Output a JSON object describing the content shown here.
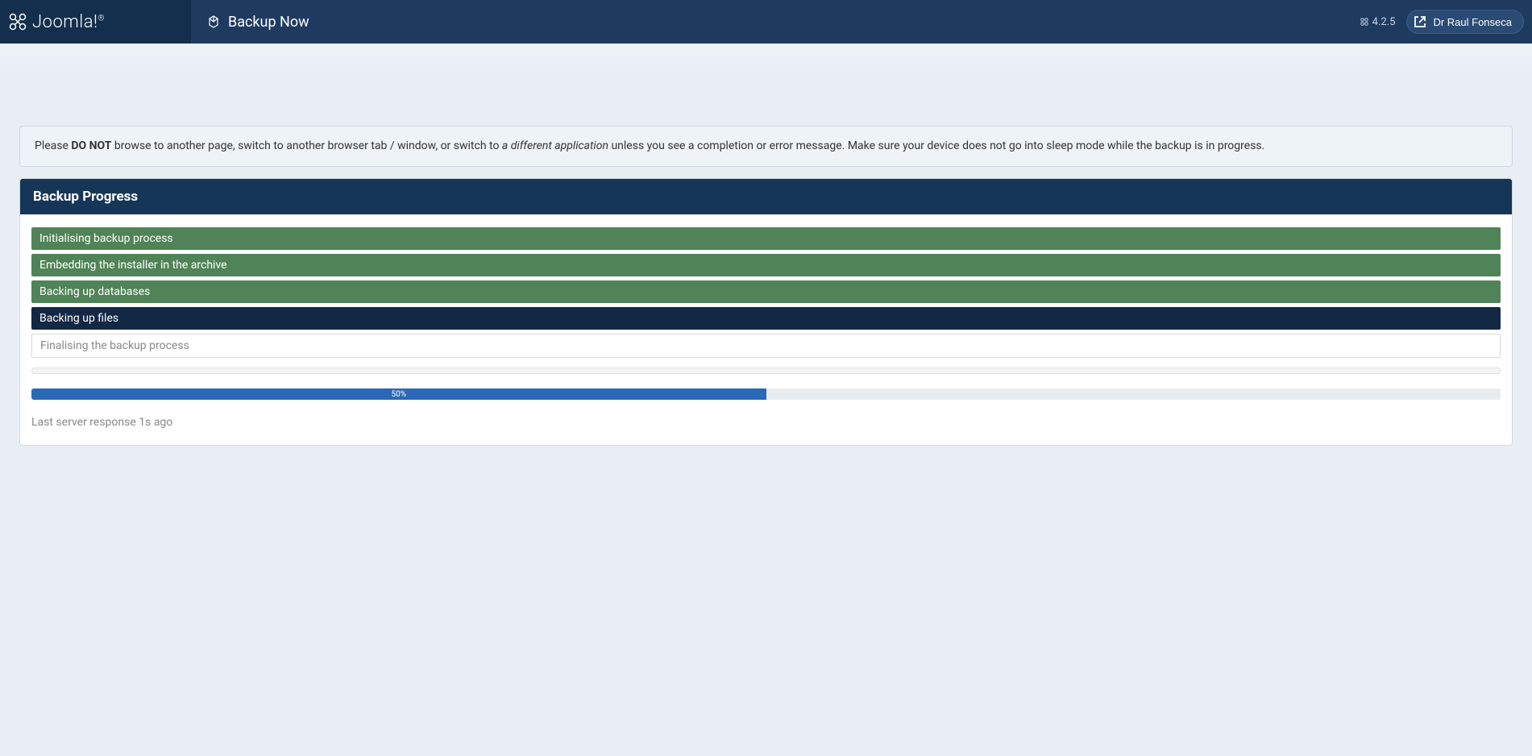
{
  "header": {
    "brand_name": "Joomla!",
    "brand_trademark": "®",
    "page_title": "Backup Now",
    "version": "4.2.5",
    "user_name": "Dr Raul Fonseca"
  },
  "notice": {
    "pre": "Please ",
    "bold": "DO NOT",
    "mid": " browse to another page, switch to another browser tab / window, or switch to ",
    "italic": "a different application",
    "post": " unless you see a completion or error message. Make sure your device does not go into sleep mode while the backup is in progress."
  },
  "panel": {
    "title": "Backup Progress",
    "steps": [
      {
        "label": "Initialising backup process",
        "state": "done"
      },
      {
        "label": "Embedding the installer in the archive",
        "state": "done"
      },
      {
        "label": "Backing up databases",
        "state": "done"
      },
      {
        "label": "Backing up files",
        "state": "active"
      },
      {
        "label": "Finalising the backup process",
        "state": "pending"
      }
    ],
    "progress_percent": 50,
    "progress_label": "50%",
    "last_response": "Last server response 1s ago"
  }
}
